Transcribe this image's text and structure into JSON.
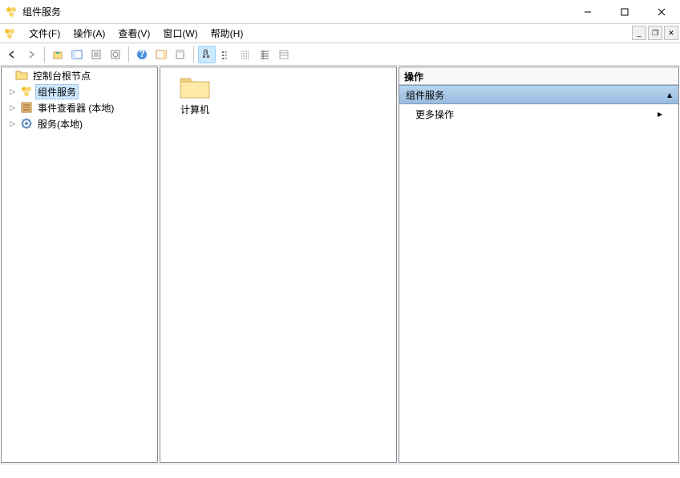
{
  "window": {
    "title": "组件服务"
  },
  "menu": {
    "file": "文件(F)",
    "action": "操作(A)",
    "view": "查看(V)",
    "window": "窗口(W)",
    "help": "帮助(H)"
  },
  "tree": {
    "root": "控制台根节点",
    "nodes": [
      {
        "label": "组件服务",
        "selected": true,
        "icon": "component"
      },
      {
        "label": "事件查看器 (本地)",
        "selected": false,
        "icon": "event"
      },
      {
        "label": "服务(本地)",
        "selected": false,
        "icon": "service"
      }
    ]
  },
  "content": {
    "items": [
      {
        "label": "计算机"
      }
    ]
  },
  "actions": {
    "header": "操作",
    "section": "组件服务",
    "more": "更多操作"
  }
}
